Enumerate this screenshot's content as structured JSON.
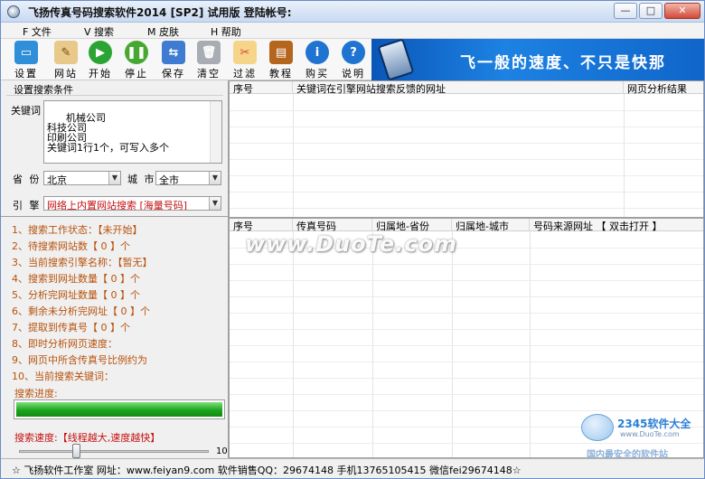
{
  "window": {
    "title": "飞扬传真号码搜索软件2014 [SP2] 试用版   登陆帐号:",
    "minimize": "—",
    "maximize": "□",
    "close": "✕"
  },
  "menu": [
    {
      "label": "F 文件"
    },
    {
      "label": "V 搜索"
    },
    {
      "label": "M 皮肤"
    },
    {
      "label": "H 帮助"
    }
  ],
  "toolbar": [
    {
      "label": "设置",
      "icon": "monitor-icon",
      "color": "#2f8fd8"
    },
    {
      "label": "网站",
      "icon": "notepad-icon",
      "color": "#c58a2c"
    },
    {
      "label": "开始",
      "icon": "play-icon",
      "color": "#2aa534"
    },
    {
      "label": "停止",
      "icon": "pause-icon",
      "color": "#46a831"
    },
    {
      "label": "保存",
      "icon": "save-icon",
      "color": "#3e7bd1"
    },
    {
      "label": "清空",
      "icon": "trash-icon",
      "color": "#8b9299"
    },
    {
      "label": "过滤",
      "icon": "filter-icon",
      "color": "#d9432c"
    },
    {
      "label": "教程",
      "icon": "book-icon",
      "color": "#b5651d"
    },
    {
      "label": "购买",
      "icon": "info-icon",
      "color": "#1f74d1"
    },
    {
      "label": "说明",
      "icon": "help-icon",
      "color": "#1f74d1"
    }
  ],
  "banner": {
    "text": "飞一般的速度、不只是快那"
  },
  "settings": {
    "section_title": "设置搜索条件",
    "keyword_label": "关键词",
    "keyword_value": "机械公司\n科技公司\n印刷公司\n关键词1行1个，可写入多个",
    "province_label": "省  份",
    "province_value": "北京",
    "city_label": "城  市",
    "city_value": "全市",
    "engine_label": "引  擎",
    "engine_value": "网络上内置网站搜索 [海量号码]"
  },
  "status_lines": [
    "1、搜索工作状态：【未开始】",
    "2、待搜索网站数【 0 】个",
    "3、当前搜索引擎名称：【暂无】",
    "4、搜索到网址数量【 0 】个",
    "5、分析完网址数量【 0 】个",
    "6、剩余未分析完网址【 0 】个",
    "7、提取到传真号【 0 】个",
    "8、即时分析网页速度：",
    "9、网页中所含传真号比例约为",
    "10、当前搜索关键词："
  ],
  "progress": {
    "label": "搜索进度:",
    "fraction": 1.0
  },
  "speed": {
    "label": "搜索速度:【线程越大,速度越快】",
    "max_label": "10",
    "level": 3
  },
  "top_grid": {
    "columns": [
      "序号",
      "关键词在引擎网站搜索反馈的网址",
      "网页分析结果"
    ]
  },
  "bottom_grid": {
    "columns": [
      "序号",
      "传真号码",
      "归属地-省份",
      "归属地-城市",
      "号码来源网址  【 双击打开 】"
    ]
  },
  "watermark": "www.DuoTe.com",
  "statusbar": "☆ 飞扬软件工作室  网址：www.feiyan9.com  软件销售QQ：29674148  手机13765105415  微信fei29674148☆",
  "corner_logo": {
    "title": "2345软件大全",
    "url": "www.DuoTe.com",
    "tagline": "国内最安全的软件站"
  }
}
